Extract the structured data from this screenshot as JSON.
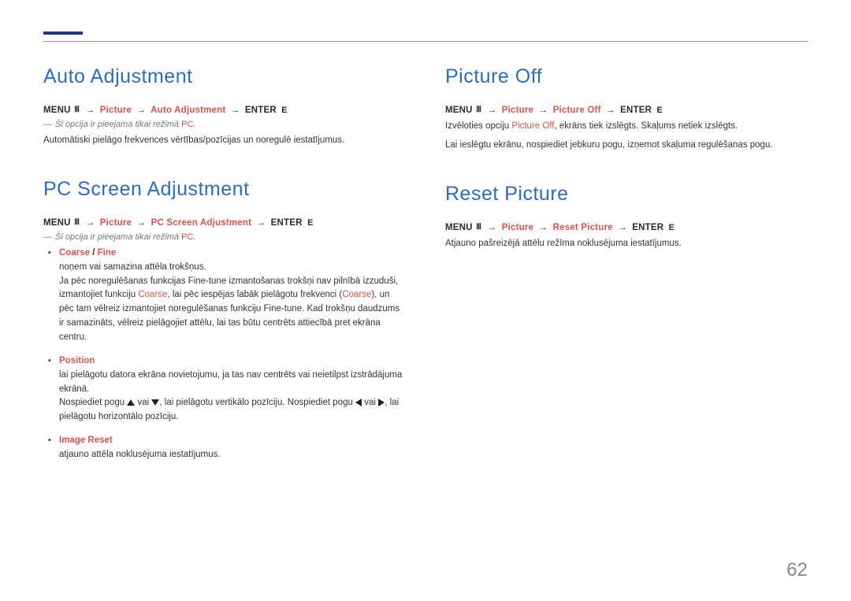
{
  "pageNumber": "62",
  "left": {
    "auto": {
      "title": "Auto Adjustment",
      "menu_prefix": "MENU",
      "path_picture": "Picture",
      "path_item": "Auto Adjustment",
      "enter_label": "ENTER",
      "note_prefix": "―",
      "note_text": "Šī opcija ir pieejama tikai režīmā ",
      "note_pc": "PC",
      "note_period": ".",
      "body": "Automātiski pielāgo frekvences vērtības/pozīcijas un noregulē iestatījumus."
    },
    "pcscreen": {
      "title": "PC Screen Adjustment",
      "menu_prefix": "MENU",
      "path_picture": "Picture",
      "path_item": "PC Screen Adjustment",
      "enter_label": "ENTER",
      "note_prefix": "―",
      "note_text": "Šī opcija ir pieejama tikai režīmā ",
      "note_pc": "PC",
      "note_period": ".",
      "items": [
        {
          "title_a": "Coarse",
          "title_sep": " / ",
          "title_b": "Fine",
          "line1": "noņem vai samazina attēla trokšņus.",
          "line2_a": "Ja pēc noregulēšanas funkcijas Fine-tune izmantošanas trokšņi nav pilnībā izzuduši, izmantojiet funkciju ",
          "line2_coarse1": "Coarse",
          "line2_b": ", lai pēc iespējas labāk pielāgotu frekvenci (",
          "line2_coarse2": "Coarse",
          "line2_c": "), un pēc tam vēlreiz izmantojiet noregulēšanas funkciju Fine-tune. Kad trokšņu daudzums ir samazināts, vēlreiz pielāgojiet attēlu, lai tas būtu centrēts attiecībā pret ekrāna centru."
        },
        {
          "title": "Position",
          "line1": "lai pielāgotu datora ekrāna novietojumu, ja tas nav centrēts vai neietilpst izstrādājuma ekrānā.",
          "line2_a": "Nospiediet pogu ",
          "line2_b": " vai ",
          "line2_c": ", lai pielāgotu vertikālo pozīciju. Nospiediet pogu ",
          "line2_d": " vai ",
          "line2_e": ", lai pielāgotu horizontālo pozīciju."
        },
        {
          "title": "Image Reset",
          "line1": "atjauno attēla noklusējuma iestatījumus."
        }
      ]
    }
  },
  "right": {
    "picoff": {
      "title": "Picture Off",
      "menu_prefix": "MENU",
      "path_picture": "Picture",
      "path_item": "Picture Off",
      "enter_label": "ENTER",
      "body1_a": "Izvēloties opciju ",
      "body1_red": "Picture Off",
      "body1_b": ", ekrāns tiek izslēgts. Skaļums netiek izslēgts.",
      "body2": "Lai ieslēgtu ekrānu, nospiediet jebkuru pogu, izņemot skaļuma regulēšanas pogu."
    },
    "reset": {
      "title": "Reset Picture",
      "menu_prefix": "MENU",
      "path_picture": "Picture",
      "path_item": "Reset Picture",
      "enter_label": "ENTER",
      "body": "Atjauno pašreizējā attēlu režīma noklusējuma iestatījumus."
    }
  }
}
